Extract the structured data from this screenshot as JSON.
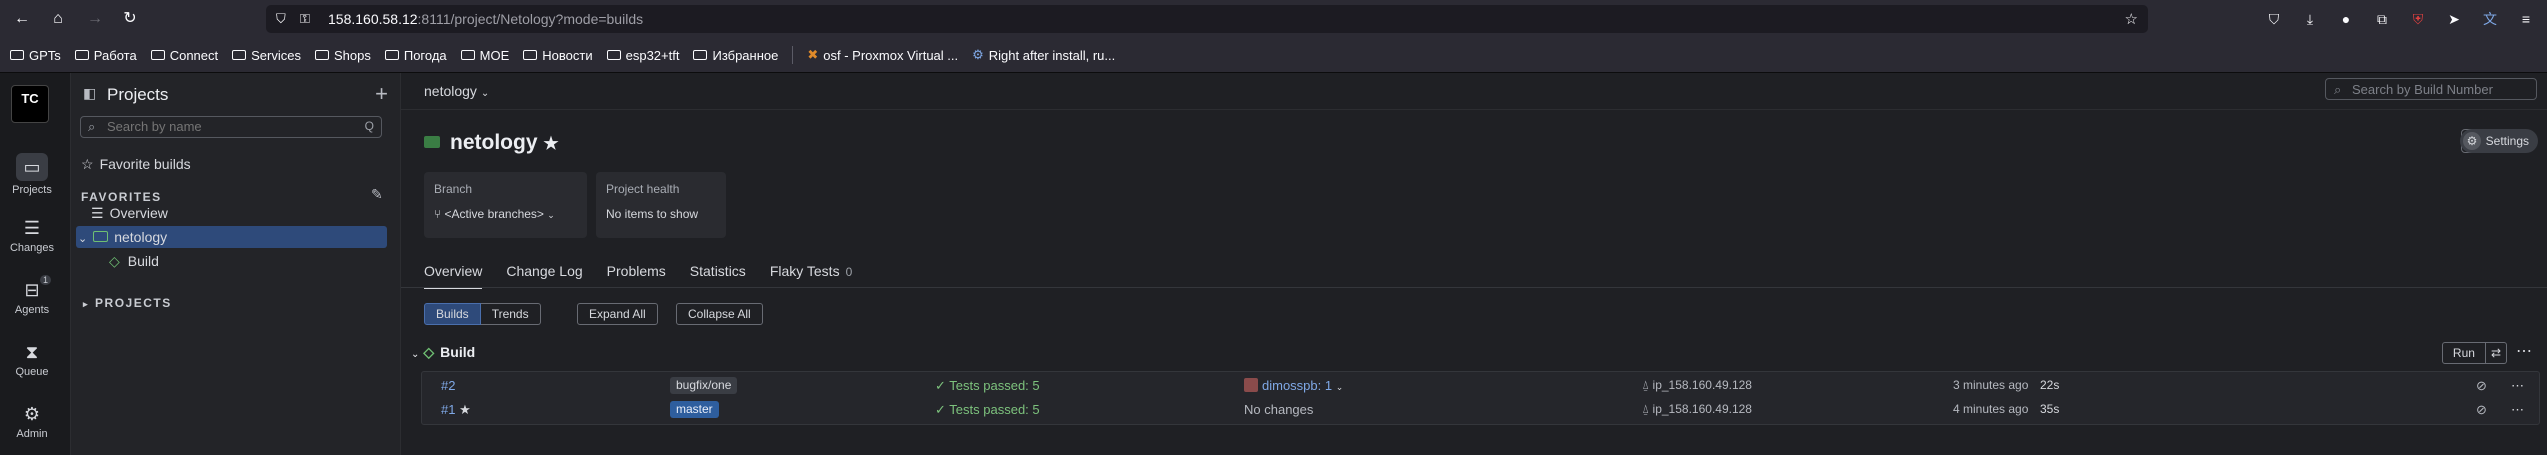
{
  "browser": {
    "url_host": "158.160.58.12",
    "url_rest": ":8111/project/Netology?mode=builds",
    "bookmarks": [
      "GPTs",
      "Работа",
      "Connect",
      "Services",
      "Shops",
      "Погода",
      "MOE",
      "Новости",
      "esp32+tft",
      "Избранное",
      "osf - Proxmox Virtual ...",
      "Right after install, ru..."
    ]
  },
  "leftbar": {
    "logo": "TC",
    "items": [
      {
        "label": "Projects",
        "icon": "folder-icon"
      },
      {
        "label": "Changes",
        "icon": "changes-icon"
      },
      {
        "label": "Agents",
        "icon": "agents-icon",
        "badge": "1"
      },
      {
        "label": "Queue",
        "icon": "hourglass-icon"
      },
      {
        "label": "Admin",
        "icon": "gear-icon"
      }
    ]
  },
  "sidebar": {
    "title": "Projects",
    "search_placeholder": "Search by name",
    "favorite_builds": "Favorite builds",
    "favorites_heading": "FAVORITES",
    "overview": "Overview",
    "project": "netology",
    "build": "Build",
    "projects_heading": "PROJECTS"
  },
  "header": {
    "breadcrumb": "netology",
    "build_search_placeholder": "Search by Build Number",
    "project_title": "netology",
    "settings_label": "Settings"
  },
  "cards": {
    "branch_label": "Branch",
    "branch_value": "<Active branches>",
    "health_label": "Project health",
    "health_value": "No items to show"
  },
  "tabs": [
    {
      "label": "Overview",
      "active": true
    },
    {
      "label": "Change Log"
    },
    {
      "label": "Problems"
    },
    {
      "label": "Statistics"
    },
    {
      "label": "Flaky Tests",
      "count": "0"
    }
  ],
  "view": {
    "builds": "Builds",
    "trends": "Trends",
    "expand_all": "Expand All",
    "collapse_all": "Collapse All"
  },
  "build_type": {
    "title": "Build",
    "run_label": "Run"
  },
  "builds": [
    {
      "number": "#2",
      "branch": "bugfix/one",
      "branch_color": "#3a3d44",
      "status": "Tests passed: 5",
      "changes": "dimosspb: 1",
      "agent": "ip_158.160.49.128",
      "time": "3 minutes ago",
      "duration": "22s"
    },
    {
      "number": "#1",
      "branch": "master",
      "branch_color": "#2e5e9e",
      "status": "Tests passed: 5",
      "changes": "No changes",
      "agent": "ip_158.160.49.128",
      "time": "4 minutes ago",
      "duration": "35s"
    }
  ],
  "colors": {
    "accent": "#2e4a7a",
    "success": "#7dc27d",
    "link": "#7fa8e6"
  }
}
